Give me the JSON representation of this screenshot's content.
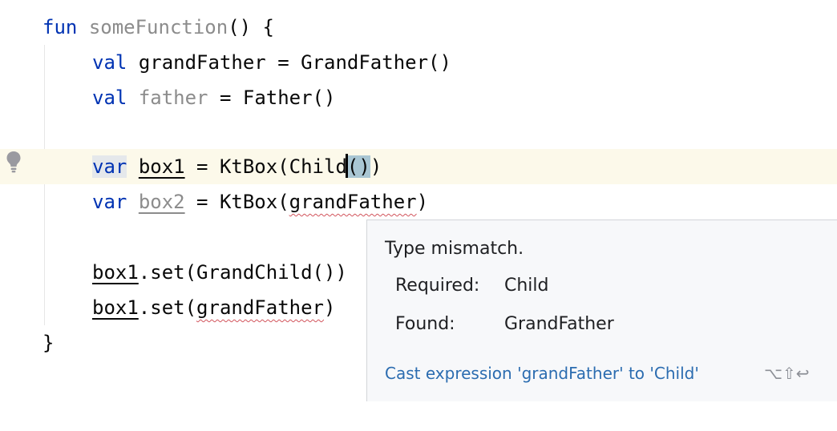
{
  "code": {
    "line1": {
      "kw": "fun",
      "name": "someFunction",
      "rest": "() {"
    },
    "line2": {
      "kw": "val",
      "rest": "grandFather = GrandFather()"
    },
    "line3": {
      "kw": "val",
      "name": "father",
      "rest": " = Father()"
    },
    "line5": {
      "kw": "var",
      "name": "box1",
      "mid": " = KtBox(Child",
      "paren": "()",
      "end": ")"
    },
    "line6": {
      "kw": "var",
      "name": "box2",
      "mid": " = KtBox(",
      "arg": "grandFather",
      "end": ")"
    },
    "line8": {
      "name": "box1",
      "rest": ".set(GrandChild())"
    },
    "line9": {
      "name": "box1",
      "mid": ".set(",
      "arg": "grandFather",
      "end": ")"
    },
    "line10": {
      "text": "}"
    }
  },
  "gutter": {
    "icon": "lightbulb-icon"
  },
  "popup": {
    "title": "Type mismatch.",
    "required_label": "Required:",
    "required_value": "Child",
    "found_label": "Found:",
    "found_value": "GrandFather",
    "action": "Cast expression 'grandFather' to 'Child'",
    "shortcut": "⌥⇧↩"
  },
  "colors": {
    "keyword": "#0033b3",
    "unused": "#8c8c8c",
    "error_squiggle": "#d2545c",
    "current_line": "#fcf9ea",
    "action_link": "#2b6cb0"
  }
}
